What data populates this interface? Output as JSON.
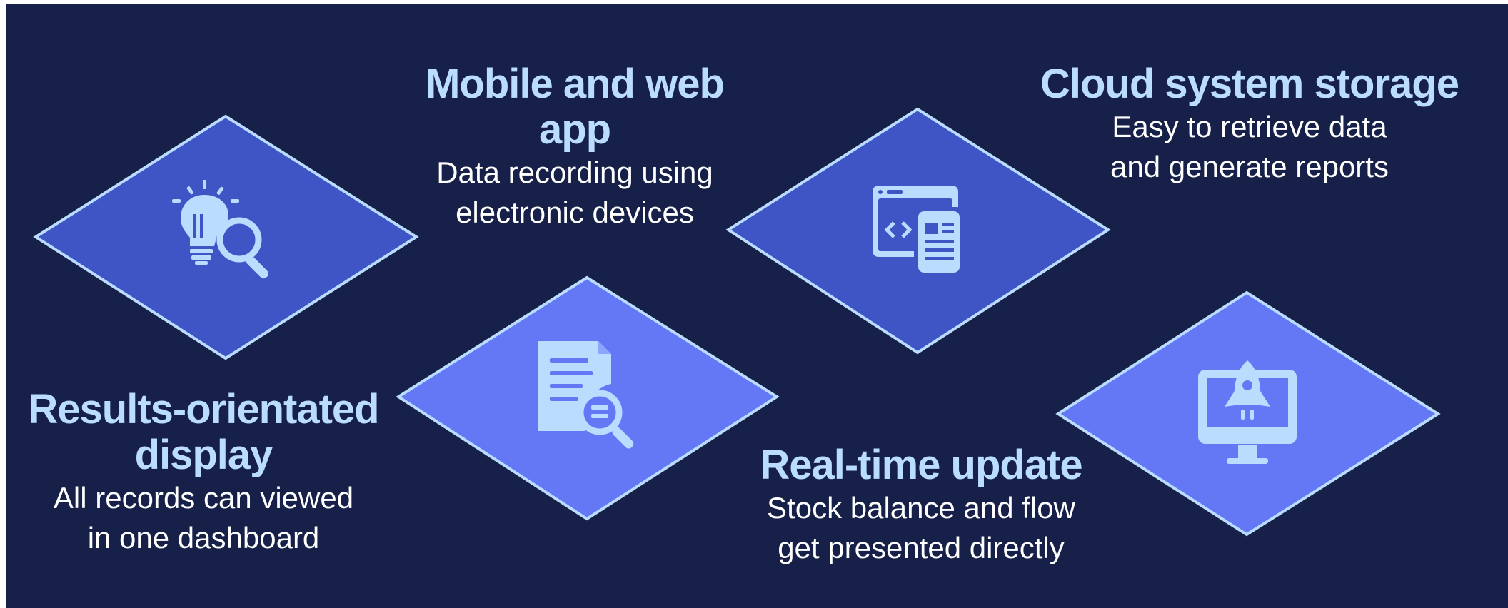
{
  "colors": {
    "background": "#172048",
    "diamond_dark": "#3f55c6",
    "diamond_light": "#6478f6",
    "diamond_border": "#b9dcff",
    "icon": "#b9dcff",
    "title_text": "#b9dcff",
    "body_text": "#ffffff"
  },
  "icons": {
    "results": "lightbulb-magnifier-icon",
    "mobile_web": "document-magnifier-icon",
    "cloud": "browser-code-mobile-icon",
    "realtime": "monitor-rocket-icon"
  },
  "features": {
    "results": {
      "title": "Results-orientated display",
      "desc_line1": "All records can viewed",
      "desc_line2": "in one dashboard"
    },
    "mobile_web": {
      "title": "Mobile and web app",
      "desc_line1": "Data recording using",
      "desc_line2": "electronic devices"
    },
    "cloud": {
      "title": "Cloud system storage",
      "desc_line1": "Easy to retrieve data",
      "desc_line2": "and generate reports"
    },
    "realtime": {
      "title": "Real-time update",
      "desc_line1": "Stock balance and flow",
      "desc_line2": "get presented directly"
    }
  }
}
